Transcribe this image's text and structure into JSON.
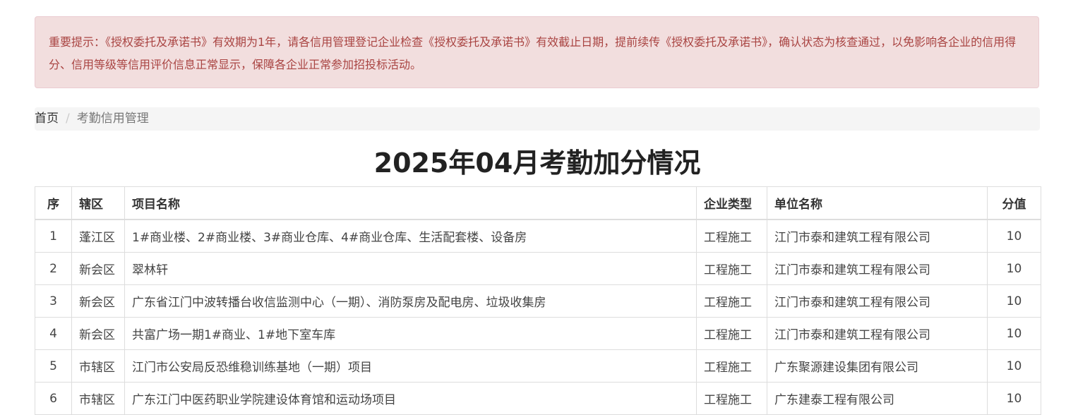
{
  "notice": {
    "text": "重要提示：《授权委托及承诺书》有效期为1年，请各信用管理登记企业检查《授权委托及承诺书》有效截止日期，提前续传《授权委托及承诺书》，确认状态为核查通过，以免影响各企业的信用得分、信用等级等信用评价信息正常显示，保障各企业正常参加招投标活动。"
  },
  "breadcrumb": {
    "home": "首页",
    "separator": "/",
    "current": "考勤信用管理"
  },
  "page": {
    "title": "2025年04月考勤加分情况"
  },
  "table": {
    "headers": {
      "index": "序",
      "district": "辖区",
      "project": "项目名称",
      "type": "企业类型",
      "company": "单位名称",
      "score": "分值"
    },
    "rows": [
      {
        "index": "1",
        "district": "蓬江区",
        "project": "1#商业楼、2#商业楼、3#商业仓库、4#商业仓库、生活配套楼、设备房",
        "type": "工程施工",
        "company": "江门市泰和建筑工程有限公司",
        "score": "10"
      },
      {
        "index": "2",
        "district": "新会区",
        "project": "翠林轩",
        "type": "工程施工",
        "company": "江门市泰和建筑工程有限公司",
        "score": "10"
      },
      {
        "index": "3",
        "district": "新会区",
        "project": "广东省江门中波转播台收信监测中心（一期）、消防泵房及配电房、垃圾收集房",
        "type": "工程施工",
        "company": "江门市泰和建筑工程有限公司",
        "score": "10"
      },
      {
        "index": "4",
        "district": "新会区",
        "project": "共富广场一期1#商业、1#地下室车库",
        "type": "工程施工",
        "company": "江门市泰和建筑工程有限公司",
        "score": "10"
      },
      {
        "index": "5",
        "district": "市辖区",
        "project": "江门市公安局反恐维稳训练基地（一期）项目",
        "type": "工程施工",
        "company": "广东聚源建设集团有限公司",
        "score": "10"
      },
      {
        "index": "6",
        "district": "市辖区",
        "project": "广东江门中医药职业学院建设体育馆和运动场项目",
        "type": "工程施工",
        "company": "广东建泰工程有限公司",
        "score": "10"
      }
    ]
  }
}
